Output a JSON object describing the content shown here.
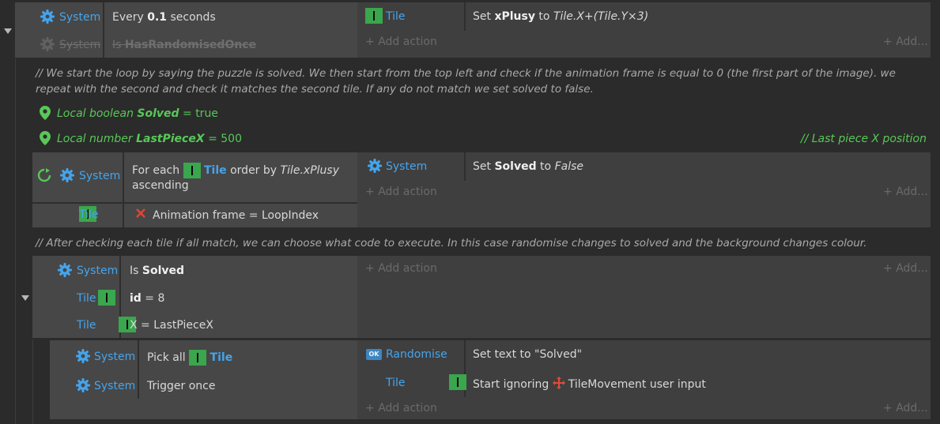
{
  "colors": {
    "object_blue": "#45a4ec",
    "local_green": "#58c858",
    "block_bg": "#474747",
    "action_bg": "#3f3f3f",
    "page_bg": "#2b2b2b",
    "tile_icon_green": "#3aa64e",
    "remove_red": "#e0443a",
    "movement_red": "#e14b3c"
  },
  "event1": {
    "condition1": {
      "object": "System",
      "prefix": "Every ",
      "value": "0.1",
      "suffix": " seconds"
    },
    "condition2": {
      "object": "System",
      "prefix": "Is ",
      "name": "HasRandomisedOnce"
    },
    "action1": {
      "object": "Tile",
      "prefix": "Set ",
      "var": "xPlusy",
      "mid": " to ",
      "expr": "Tile.X+(Tile.Y×3)"
    },
    "add_action": "Add action",
    "add_more": "Add..."
  },
  "comment1": "// We start the loop by saying the puzzle is solved. We then start from the top left and check if the animation frame is equal to 0 (the first part of the image). we repeat with the second and check it matches the second tile. If any do not match we set solved to false.",
  "local1": {
    "type": "Local boolean ",
    "name": "Solved",
    "value": " = true"
  },
  "local2": {
    "type": "Local number ",
    "name": "LastPieceX",
    "value": " = 500",
    "comment": "// Last piece X position"
  },
  "event2": {
    "condition1": {
      "object": "System",
      "prefix": "For each ",
      "tile": "Tile",
      "mid": " order by ",
      "expr": "Tile.xPlusy",
      "line2": "ascending"
    },
    "condition2": {
      "object": "Tile",
      "text": "Animation frame = LoopIndex"
    },
    "action1": {
      "object": "System",
      "prefix": "Set ",
      "var": "Solved",
      "mid": " to ",
      "value": "False"
    },
    "add_action": "Add action",
    "add_more": "Add..."
  },
  "comment2": "// After checking each tile if all match, we can choose what code to execute. In this case randomise changes to solved and the background changes colour.",
  "event3": {
    "condition1": {
      "object": "System",
      "prefix": "Is ",
      "name": "Solved"
    },
    "condition2": {
      "object": "Tile",
      "name": "id",
      "value": " = 8"
    },
    "condition3": {
      "object": "Tile",
      "text": "X = LastPieceX"
    },
    "add_action": "Add action",
    "add_more": "Add..."
  },
  "event4": {
    "condition1": {
      "object": "System",
      "prefix": "Pick all ",
      "tile": "Tile"
    },
    "condition2": {
      "object": "System",
      "text": "Trigger once"
    },
    "action1": {
      "object": "Randomise",
      "badge": "OK",
      "text": "Set text to \"Solved\""
    },
    "action2": {
      "object": "Tile",
      "prefix": "Start ignoring ",
      "suffix": "TileMovement user input"
    },
    "add_action": "Add action",
    "add_more": "Add..."
  }
}
